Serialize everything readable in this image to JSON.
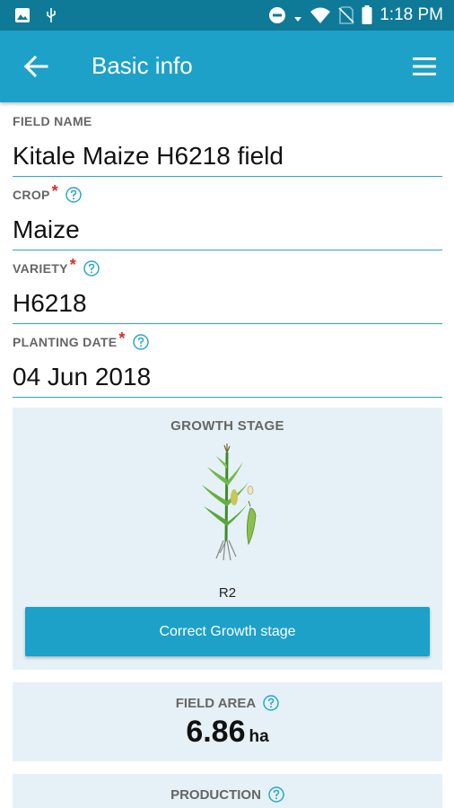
{
  "status_bar": {
    "time": "1:18 PM",
    "icons": [
      "image-icon",
      "usb-icon",
      "do-not-disturb-icon",
      "signal-arrow-icon",
      "wifi-icon",
      "no-sim-icon",
      "battery-icon"
    ]
  },
  "app_bar": {
    "title": "Basic info",
    "back_icon": "arrow-left-icon",
    "menu_icon": "hamburger-menu-icon"
  },
  "fields": {
    "field_name": {
      "label": "FIELD NAME",
      "value": "Kitale Maize H6218 field"
    },
    "crop": {
      "label": "CROP",
      "required": "*",
      "value": "Maize"
    },
    "variety": {
      "label": "VARIETY",
      "required": "*",
      "value": "H6218"
    },
    "planting_date": {
      "label": "PLANTING DATE",
      "required": "*",
      "value": "04 Jun 2018"
    }
  },
  "growth_stage": {
    "title": "GROWTH STAGE",
    "stage": "R2",
    "button_label": "Correct Growth stage"
  },
  "field_area": {
    "label": "FIELD AREA",
    "value": "6.86",
    "unit": "ha"
  },
  "production": {
    "label": "PRODUCTION"
  },
  "colors": {
    "status_bar": "#0f7a98",
    "app_bar": "#1da1c9",
    "accent": "#2ba6c9",
    "required": "#d32f2f",
    "card_bg": "#e5f1f6"
  }
}
